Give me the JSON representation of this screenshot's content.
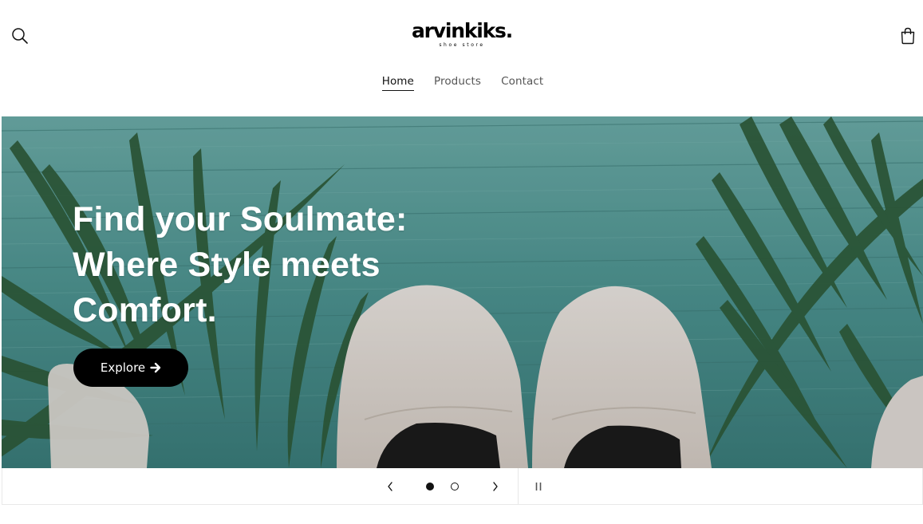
{
  "header": {
    "logo_name": "arvinkiks.",
    "logo_tagline": "shoe store",
    "nav": [
      {
        "label": "Home",
        "active": true
      },
      {
        "label": "Products",
        "active": false
      },
      {
        "label": "Contact",
        "active": false
      }
    ],
    "icons": {
      "search": "search-icon",
      "cart": "cart-icon"
    }
  },
  "hero": {
    "heading_lines": [
      "Find your Soulmate:",
      "Where Style meets",
      "Comfort."
    ],
    "button_label": "Explore",
    "button_icon": "arrow-right-icon",
    "background_color": "#4a8f8d"
  },
  "slideshow": {
    "slide_count": 2,
    "current_slide": 1,
    "icons": {
      "prev": "chevron-left-icon",
      "next": "chevron-right-icon",
      "pause": "pause-icon"
    }
  }
}
